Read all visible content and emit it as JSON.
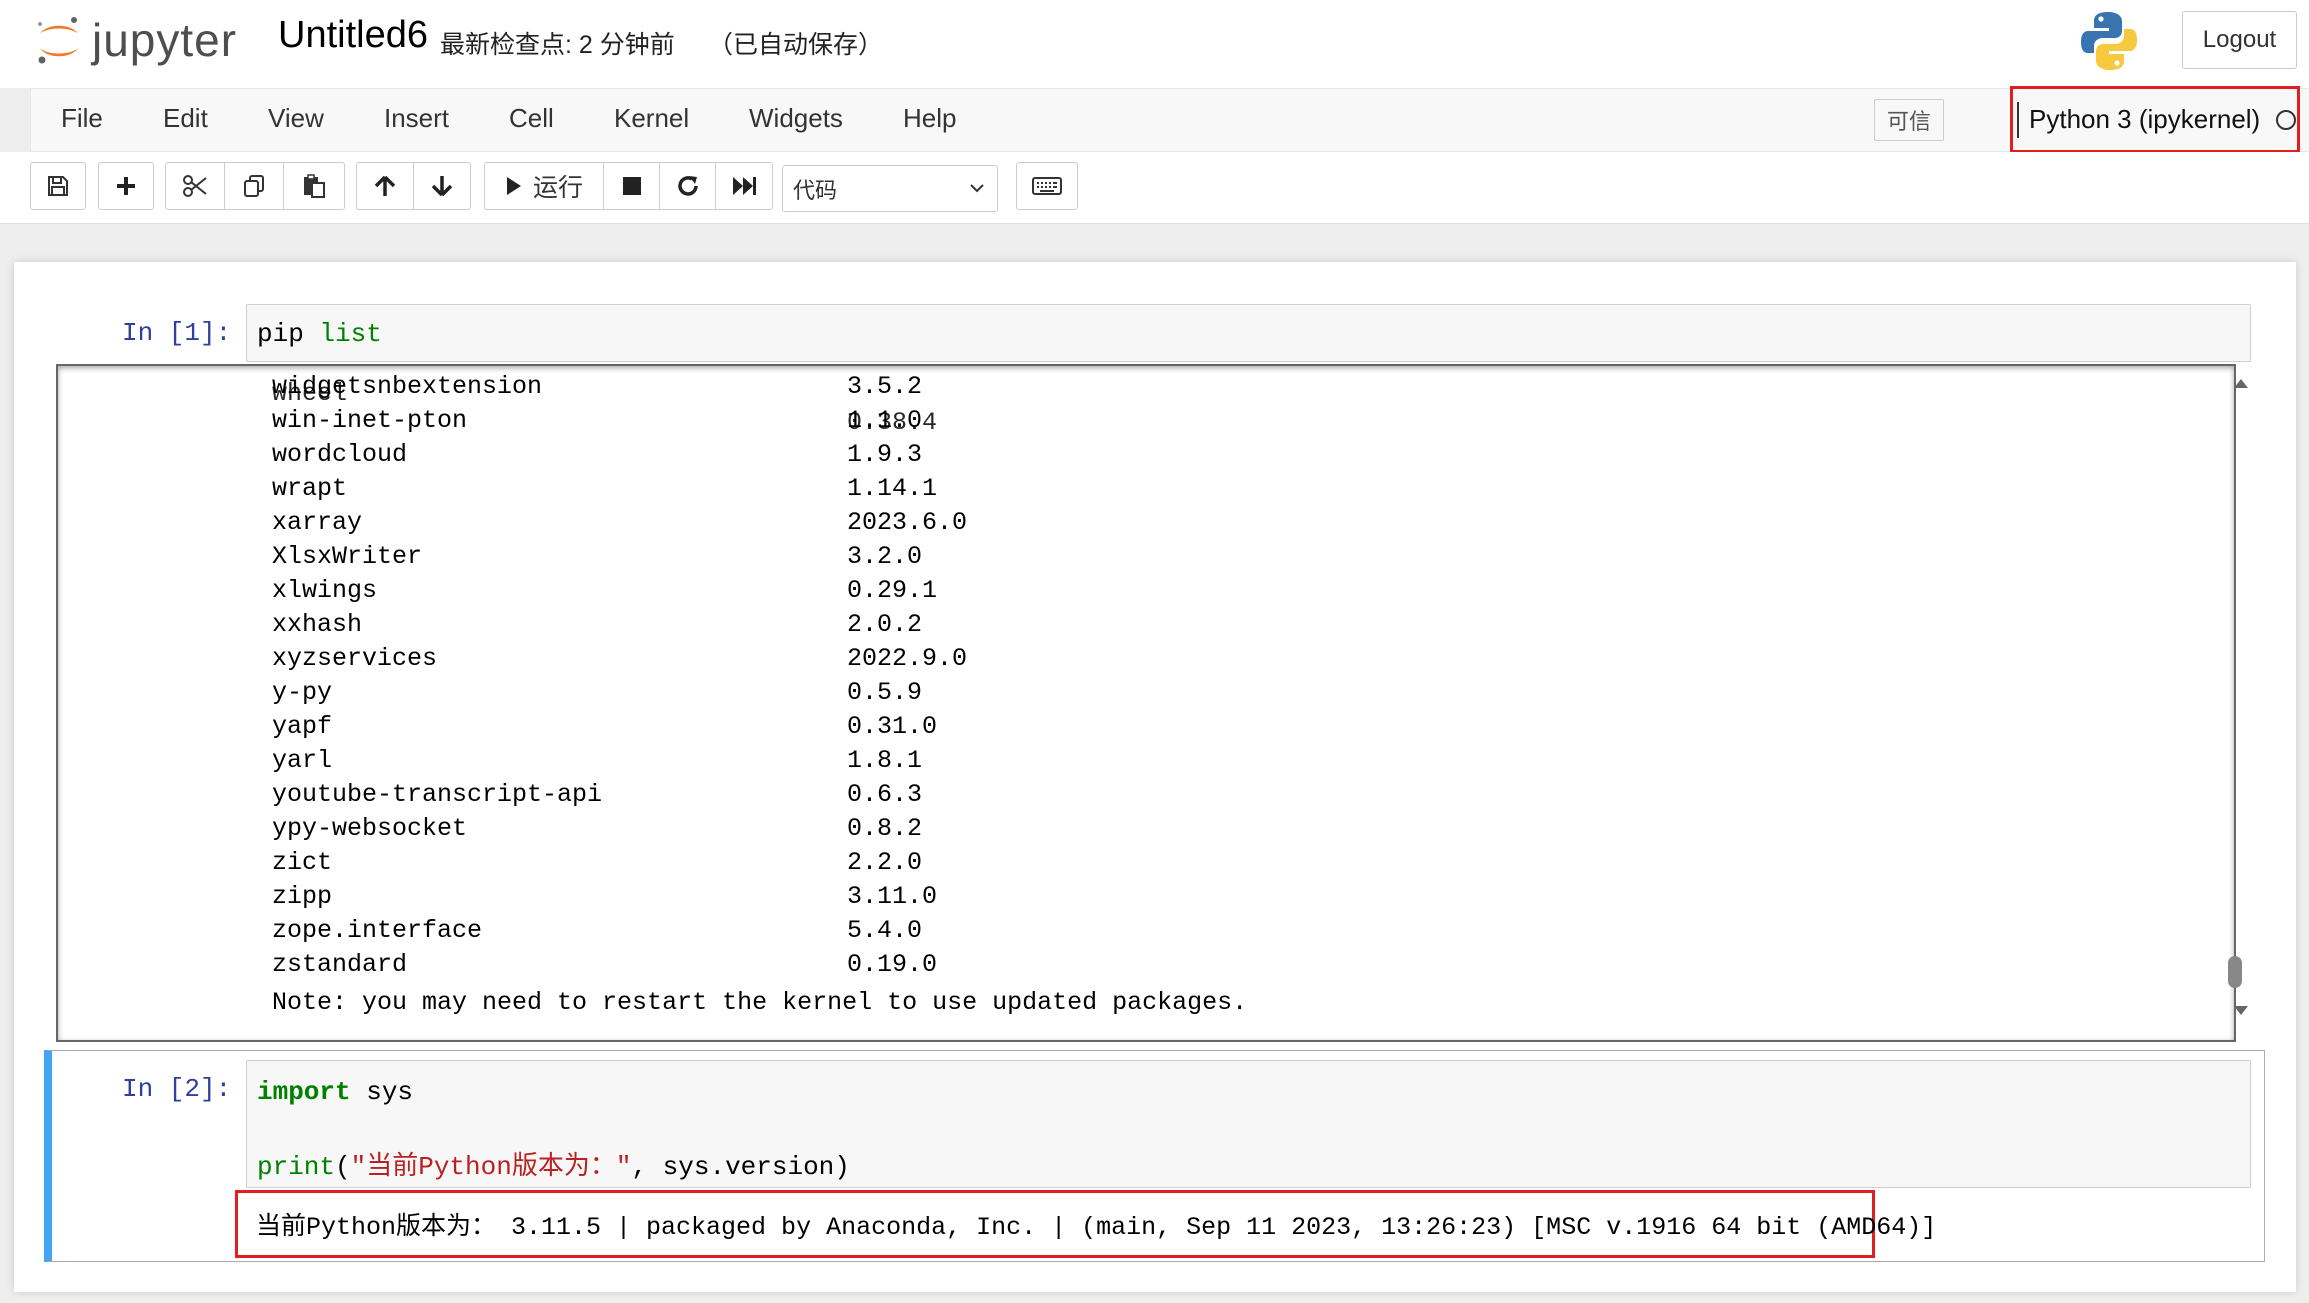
{
  "header": {
    "logo_text": "jupyter",
    "notebook_name": "Untitled6",
    "checkpoint": "最新检查点: 2 分钟前",
    "autosave": "（已自动保存）",
    "logout_label": "Logout"
  },
  "menubar": {
    "items": [
      "File",
      "Edit",
      "View",
      "Insert",
      "Cell",
      "Kernel",
      "Widgets",
      "Help"
    ],
    "trusted_label": "可信",
    "kernel_name": "Python 3 (ipykernel)"
  },
  "toolbar": {
    "run_label": "运行",
    "cell_type": "代码"
  },
  "cells": {
    "cell1": {
      "prompt": "In  [1]:",
      "code_kw": "pip",
      "code_rest": " list",
      "partial_row": {
        "name": "wheel",
        "version": "0.38.4"
      },
      "packages": [
        {
          "name": "widgetsnbextension",
          "version": "3.5.2"
        },
        {
          "name": "win-inet-pton",
          "version": "1.1.0"
        },
        {
          "name": "wordcloud",
          "version": "1.9.3"
        },
        {
          "name": "wrapt",
          "version": "1.14.1"
        },
        {
          "name": "xarray",
          "version": "2023.6.0"
        },
        {
          "name": "XlsxWriter",
          "version": "3.2.0"
        },
        {
          "name": "xlwings",
          "version": "0.29.1"
        },
        {
          "name": "xxhash",
          "version": "2.0.2"
        },
        {
          "name": "xyzservices",
          "version": "2022.9.0"
        },
        {
          "name": "y-py",
          "version": "0.5.9"
        },
        {
          "name": "yapf",
          "version": "0.31.0"
        },
        {
          "name": "yarl",
          "version": "1.8.1"
        },
        {
          "name": "youtube-transcript-api",
          "version": "0.6.3"
        },
        {
          "name": "ypy-websocket",
          "version": "0.8.2"
        },
        {
          "name": "zict",
          "version": "2.2.0"
        },
        {
          "name": "zipp",
          "version": "3.11.0"
        },
        {
          "name": "zope.interface",
          "version": "5.4.0"
        },
        {
          "name": "zstandard",
          "version": "0.19.0"
        }
      ],
      "note": "Note: you may need to restart the kernel to use updated packages."
    },
    "cell2": {
      "prompt": "In  [2]:",
      "line1_kw": "import",
      "line1_rest": " sys",
      "line2_fn": "print",
      "line2_open": "(",
      "line2_str": "\"当前Python版本为：\"",
      "line2_rest": ", sys.version)",
      "output": "当前Python版本为： 3.11.5 | packaged by Anaconda, Inc. | (main, Sep 11 2023, 13:26:23) [MSC v.1916 64 bit (AMD64)]"
    }
  }
}
